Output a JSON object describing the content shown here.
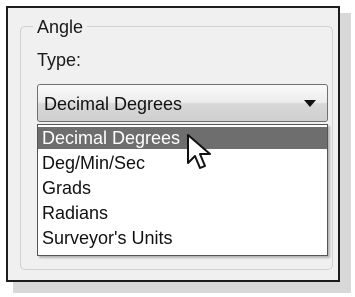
{
  "group": {
    "title": "Angle"
  },
  "type_label": "Type:",
  "combo": {
    "selected_value": "Decimal Degrees",
    "arrow_icon": "chevron-down-icon"
  },
  "dropdown": {
    "options": [
      {
        "label": "Decimal Degrees",
        "highlighted": true
      },
      {
        "label": "Deg/Min/Sec",
        "highlighted": false
      },
      {
        "label": "Grads",
        "highlighted": false
      },
      {
        "label": "Radians",
        "highlighted": false
      },
      {
        "label": "Surveyor's Units",
        "highlighted": false
      }
    ]
  },
  "colors": {
    "highlight": "#6e6e6e",
    "panel_background": "#f0f0f0"
  }
}
